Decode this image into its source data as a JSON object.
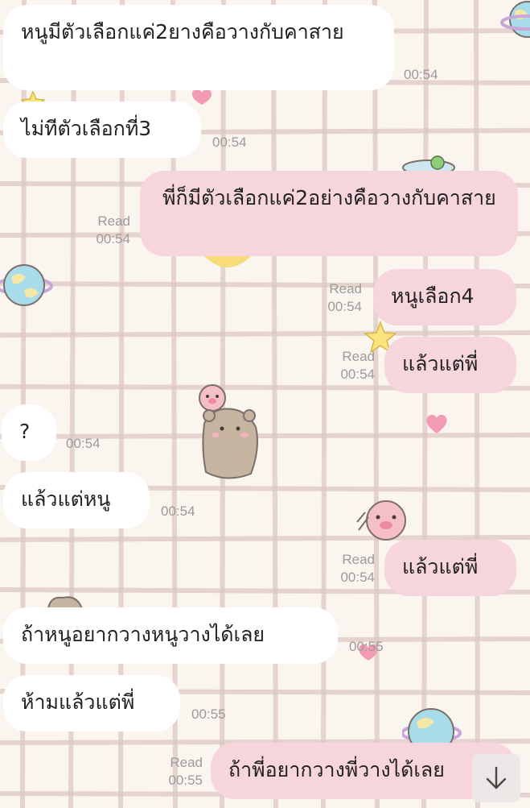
{
  "messages": [
    {
      "id": "m1",
      "side": "in",
      "text": "หนูมีตัวเลือกแค่2ยางคือวางกับคาสาย",
      "time": "00:54",
      "read": ""
    },
    {
      "id": "m2",
      "side": "in",
      "text": "ไม่ทีตัวเลือกที่3",
      "time": "00:54",
      "read": ""
    },
    {
      "id": "m3",
      "side": "out",
      "text": "พี่ก็มีตัวเลือกแค่2อย่างคือวางกับคาสาย",
      "time": "00:54",
      "read": "Read"
    },
    {
      "id": "m4",
      "side": "out",
      "text": "หนูเลือก4",
      "time": "00:54",
      "read": "Read"
    },
    {
      "id": "m5",
      "side": "out",
      "text": "แล้วแต่พี่",
      "time": "00:54",
      "read": "Read"
    },
    {
      "id": "m6",
      "side": "in",
      "text": "?",
      "time": "00:54",
      "read": ""
    },
    {
      "id": "m7",
      "side": "in",
      "text": "แล้วแต่หนู",
      "time": "00:54",
      "read": ""
    },
    {
      "id": "m8",
      "side": "out",
      "text": "แล้วแต่พี่",
      "time": "00:54",
      "read": "Read"
    },
    {
      "id": "m9",
      "side": "in",
      "text": "ถ้าหนูอยากวางหนูวางได้เลย",
      "time": "00:55",
      "read": ""
    },
    {
      "id": "m10",
      "side": "in",
      "text": "ห้ามแล้วแต่พี่",
      "time": "00:55",
      "read": ""
    },
    {
      "id": "m11",
      "side": "out",
      "text": "ถ้าพี่อยากวางพี่วางได้เลย",
      "time": "00:55",
      "read": "Read"
    }
  ],
  "theme": {
    "background": "#fbf5ef",
    "grid_line": "#d9c3c0",
    "incoming_bubble": "#ffffff",
    "outgoing_bubble": "#f7d5dc",
    "text": "#222222",
    "meta_text": "#9d9a98"
  },
  "icons": {
    "scroll_down": "arrow-down-icon"
  }
}
